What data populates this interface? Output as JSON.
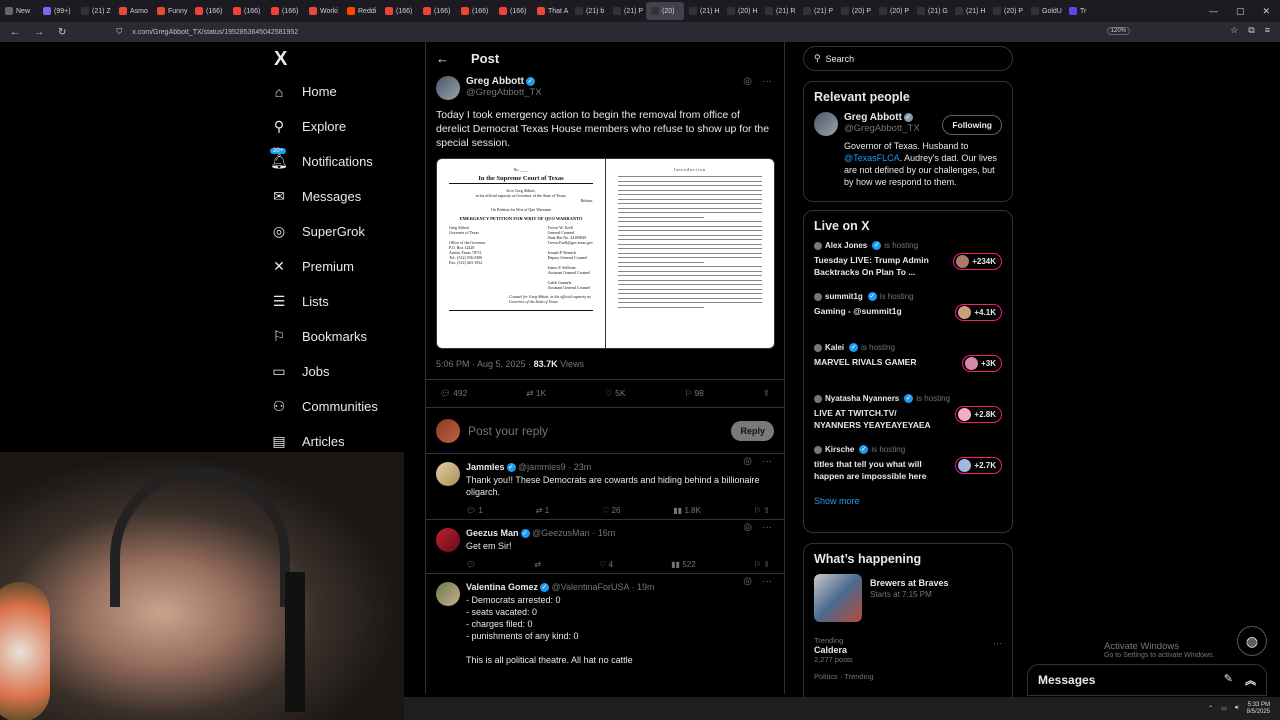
{
  "browser": {
    "tabs": [
      "New",
      "(99+)",
      "(21) Z",
      "Asmo",
      "Funny",
      "(166)",
      "(166)",
      "(166)",
      "Worki",
      "Reddi",
      "(166)",
      "(166)",
      "(166)",
      "(166)",
      "That A",
      "(21) b",
      "(21) P",
      "(20)",
      "(21) H",
      "(20) H",
      "(21) R",
      "(21) P",
      "(20) P",
      "(20) P",
      "(21) G",
      "(21) H",
      "(20) P",
      "GoldU",
      "Tr"
    ],
    "active_tab_index": 17,
    "url": "x.com/GregAbbott_TX/status/1952853645042581952",
    "zoom": "120%"
  },
  "nav": {
    "logo": "X",
    "notif_badge": "20+",
    "items": [
      "Home",
      "Explore",
      "Notifications",
      "Messages",
      "SuperGrok",
      "Premium",
      "Lists",
      "Bookmarks",
      "Jobs",
      "Communities",
      "Articles"
    ]
  },
  "post": {
    "header": "Post",
    "author_name": "Greg Abbott",
    "author_handle": "@GregAbbott_TX",
    "text": "Today I took emergency action to begin the removal from office of derelict Democrat Texas House members who refuse to show up for the special session.",
    "document": {
      "no_label": "No. ____",
      "court": "In the Supreme Court of Texas",
      "in_re": "In re Greg Abbott,",
      "capacity": "in his official capacity as Governor of the State of Texas,",
      "relator": "Relator.",
      "original": "On Petition for Writ of Quo Warranto",
      "petition": "EMERGENCY PETITION FOR WRIT OF QUO WARRANTO",
      "left_col": [
        "Greg Abbott",
        "Governor of Texas",
        "",
        "Office of the Governor",
        "P.O. Box 12428",
        "Austin, Texas 78711",
        "Tel.: (512) 936-3306",
        "Fax: (512) 463-1932"
      ],
      "right_col": [
        "Trevor W. Ezell",
        "General Counsel",
        "State Bar No. 24109849",
        "Trevor.Ezell@gov.texas.gov",
        "",
        "Joseph P. Bernick",
        "Deputy General Counsel",
        "",
        "James P. Sullivan",
        "Assistant General Counsel",
        "",
        "Caleb Gunnels",
        "Assistant General Counsel"
      ],
      "counsel": "Counsel for Greg Abbott, in his official capacity as Governor of the State of Texas",
      "intro_heading": "Introduction"
    },
    "timestamp": "5:06 PM · Aug 5, 2025 ·",
    "views_count": "83.7K",
    "views_label": "Views",
    "stats": {
      "replies": "492",
      "reposts": "1K",
      "likes": "5K",
      "bookmarks": "98"
    },
    "reply_placeholder": "Post your reply",
    "reply_button": "Reply"
  },
  "replies": [
    {
      "name": "Jammles",
      "handle": "@jammles9 · 23m",
      "text": "Thank you!! These Democrats are cowards and hiding behind a billionaire oligarch.",
      "replies": "1",
      "reposts": "1",
      "likes": "26",
      "views": "1.8K"
    },
    {
      "name": "Geezus Man",
      "handle": "@GeezusMan · 16m",
      "text": "Get em Sir!",
      "replies": "",
      "reposts": "",
      "likes": "4",
      "views": "522"
    },
    {
      "name": "Valentina Gomez",
      "handle": "@ValentinaForUSA · 19m",
      "lines": [
        "- Democrats arrested: 0",
        "- seats vacated: 0",
        "- charges filed: 0",
        "- punishments of any kind: 0",
        "",
        "This is all political theatre. All hat no cattle"
      ]
    }
  ],
  "sidebar": {
    "search_placeholder": "Search",
    "relevant_title": "Relevant people",
    "rp_name": "Greg Abbott",
    "rp_handle": "@GregAbbott_TX",
    "rp_follow": "Following",
    "rp_bio_1": "Governor of Texas. Husband to",
    "rp_bio_link": "@TexasFLCA",
    "rp_bio_2": ". Audrey's dad. Our lives are not defined by our challenges, but by how we respond to them.",
    "live_title": "Live on X",
    "live": [
      {
        "host": "Alex Jones",
        "hosting": "is hosting",
        "title": "Tuesday LIVE: Trump Admin Backtracks On Plan To ...",
        "count": "+234K"
      },
      {
        "host": "summit1g",
        "hosting": "is hosting",
        "title": "Gaming - @summit1g",
        "count": "+4.1K"
      },
      {
        "host": "Kalei",
        "hosting": "is hosting",
        "title": "MARVEL RIVALS GAMER",
        "count": "+3K"
      },
      {
        "host": "Nyatasha Nyanners",
        "hosting": "is hosting",
        "title": "LIVE AT TWITCH.TV/ NYANNERS YEAYEAYEYAEA",
        "count": "+2.8K"
      },
      {
        "host": "Kirsche",
        "hosting": "is hosting",
        "title": "titles that tell you what will happen are impossible here",
        "count": "+2.7K"
      }
    ],
    "show_more": "Show more",
    "happening_title": "What’s happening",
    "happening_item": "Brewers at Braves",
    "happening_time": "Starts at 7:15 PM",
    "trend_label": "Trending",
    "trend_name": "Caldera",
    "trend_posts": "2,277 posts",
    "trend_next": "Politics · Trending"
  },
  "overlay": {
    "activate_title": "Activate Windows",
    "activate_sub": "Go to Settings to activate Windows.",
    "messages_bar": "Messages"
  },
  "taskbar": {
    "time": "5:33 PM",
    "date": "8/5/2025"
  },
  "colors": {
    "accent": "#1d9bf0",
    "live_ring": "#f91880",
    "background": "#000000"
  }
}
